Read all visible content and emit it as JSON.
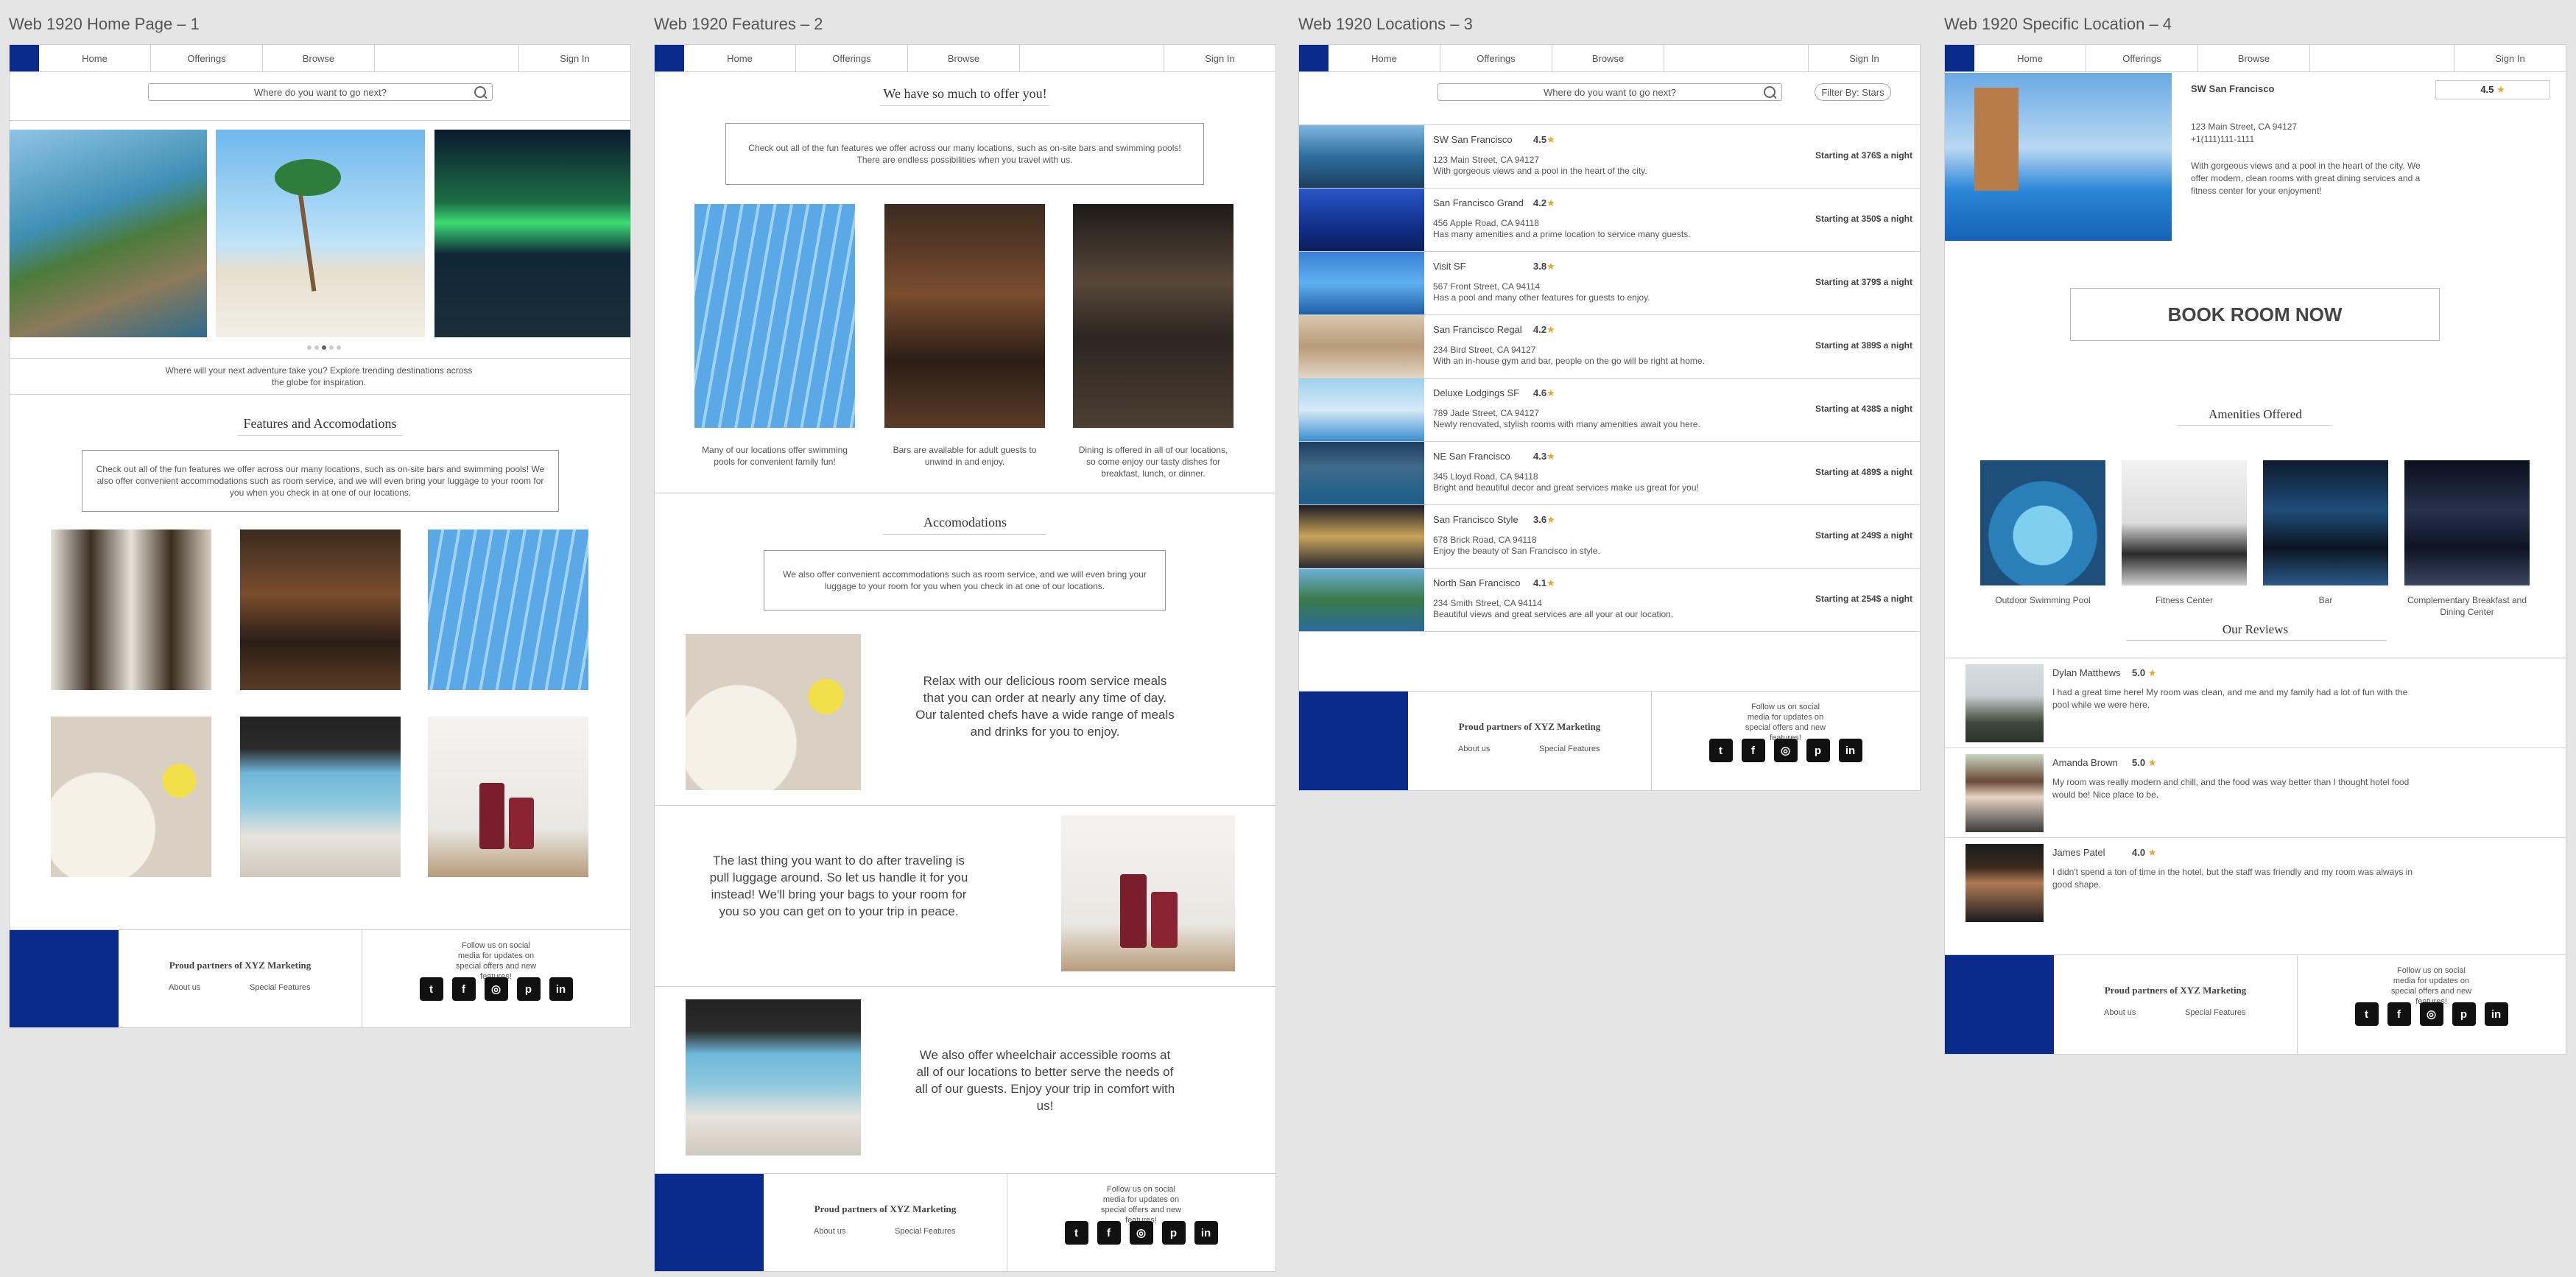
{
  "frames": {
    "f1": "Web 1920 Home Page – 1",
    "f2": "Web 1920 Features – 2",
    "f3": "Web 1920 Locations – 3",
    "f4": "Web 1920 Specific Location – 4"
  },
  "nav": {
    "home": "Home",
    "offerings": "Offerings",
    "browse": "Browse",
    "signin": "Sign In"
  },
  "search": {
    "placeholder": "Where do you want to go next?",
    "filter": "Filter By: Stars"
  },
  "home": {
    "hero_caption": "Where will your next adventure take you? Explore trending destinations across the globe for inspiration.",
    "features_heading": "Features and Accomodations",
    "features_text": "Check out all of the fun features we offer across our many locations, such as on-site bars and swimming pools! We also offer convenient accommodations such as room service, and we will even bring your luggage to your room for you when you check in at one of our locations."
  },
  "features": {
    "heading": "We have so much to offer you!",
    "intro": "Check out all of the fun features we offer across our many locations, such as on-site bars and swimming pools! There are endless possibilities when you travel with us.",
    "cap1": "Many of our locations offer swimming pools for convenient family fun!",
    "cap2": "Bars are available for adult guests to unwind in and enjoy.",
    "cap3": "Dining is offered in all of our locations, so come enjoy our tasty dishes for breakfast, lunch, or dinner.",
    "acc_heading": "Accomodations",
    "acc_intro": "We also offer convenient accommodations such as room service, and we will even bring your luggage to your room for you when you check in at one of our locations.",
    "room_service": "Relax with our delicious room service meals that you can order at nearly any time of day. Our talented chefs have a wide range of meals and drinks for you to enjoy.",
    "luggage": "The last thing you want to do after traveling is pull luggage around. So let us handle it for you instead! We'll bring your bags to your room for you so you can get on to your trip in peace.",
    "wheelchair": "We also offer wheelchair accessible rooms at all of our locations to better serve the needs of all of our guests. Enjoy your trip in comfort with us!"
  },
  "locations": [
    {
      "name": "SW San Francisco",
      "rating": "4.5",
      "address": "123 Main Street, CA 94127",
      "desc": "With gorgeous views and a pool in the heart of the city.",
      "price": "Starting at 376$ a night"
    },
    {
      "name": "San Francisco Grand",
      "rating": "4.2",
      "address": "456 Apple Road, CA 94118",
      "desc": "Has many amenities and a prime location to service many guests.",
      "price": "Starting at 350$ a night"
    },
    {
      "name": "Visit SF",
      "rating": "3.8",
      "address": "567 Front Street, CA 94114",
      "desc": "Has a pool and many other features for guests to enjoy.",
      "price": "Starting at 379$ a night"
    },
    {
      "name": "San Francisco Regal",
      "rating": "4.2",
      "address": "234 Bird Street, CA 94127",
      "desc": "With an in-house gym and bar, people on the go will be right at home.",
      "price": "Starting at 389$ a night"
    },
    {
      "name": "Deluxe Lodgings SF",
      "rating": "4.6",
      "address": "789 Jade Street, CA 94127",
      "desc": "Newly renovated, stylish rooms with many amenities await you here.",
      "price": "Starting at 438$ a night"
    },
    {
      "name": "NE San Francisco",
      "rating": "4.3",
      "address": "345 Lloyd Road, CA 94118",
      "desc": "Bright and beautiful decor and great services make us great for you!",
      "price": "Starting at 489$ a night"
    },
    {
      "name": "San Francisco Style",
      "rating": "3.6",
      "address": "678 Brick Road, CA 94118",
      "desc": "Enjoy the beauty of San Francisco in style.",
      "price": "Starting at 249$ a night"
    },
    {
      "name": "North San Francisco",
      "rating": "4.1",
      "address": "234 Smith Street, CA 94114",
      "desc": "Beautiful views and great services are all your at our location.",
      "price": "Starting at 254$ a night"
    }
  ],
  "specific": {
    "name": "SW San Francisco",
    "rating": "4.5",
    "address": "123 Main Street, CA 94127",
    "phone": "+1(111)111-1111",
    "desc": "With gorgeous views and a pool in the heart of the city. We offer modern, clean rooms with great dining services and a fitness center for your enjoyment!",
    "book": "BOOK ROOM NOW",
    "amenities_heading": "Amenities Offered",
    "amenities": [
      "Outdoor Swimming Pool",
      "Fitness Center",
      "Bar",
      "Complementary Breakfast and Dining Center"
    ],
    "reviews_heading": "Our Reviews",
    "reviews": [
      {
        "name": "Dylan Matthews",
        "rating": "5.0",
        "text": "I had a great time here! My room was clean, and me and my family had a lot of fun with the pool while we were here."
      },
      {
        "name": "Amanda Brown",
        "rating": "5.0",
        "text": "My room was really modern and chill, and the food was way better than I thought hotel food would be! Nice place to be."
      },
      {
        "name": "James Patel",
        "rating": "4.0",
        "text": "I didn't spend a ton of time in the hotel, but the staff was friendly and my room was always in good shape."
      }
    ]
  },
  "footer": {
    "partners": "Proud partners of XYZ Marketing",
    "about": "About us",
    "special": "Special Features",
    "follow": "Follow us on social media for updates on special offers and new features!"
  },
  "social_icons": [
    "twitter-icon",
    "facebook-icon",
    "instagram-icon",
    "pinterest-icon",
    "linkedin-icon"
  ],
  "colors": {
    "brand": "#0a2a8c",
    "star": "#e7a82b"
  }
}
